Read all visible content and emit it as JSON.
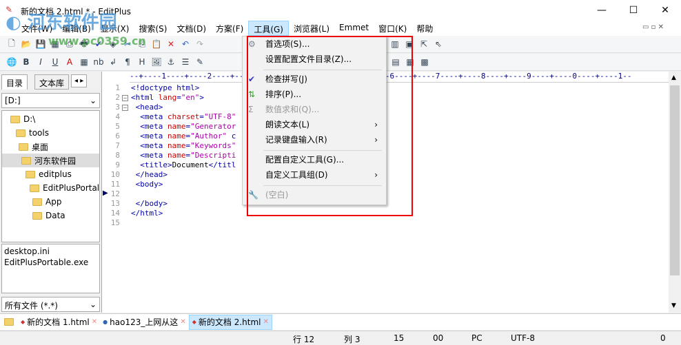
{
  "window": {
    "title": "新的文档 2.html * - EditPlus",
    "minimize": "—",
    "maximize": "☐",
    "close": "✕"
  },
  "watermark": {
    "name": "河东软件园",
    "url": "www.pc0359.cn"
  },
  "menubar": [
    "文件(W)",
    "编辑(B)",
    "显示(X)",
    "搜索(S)",
    "文档(D)",
    "方案(F)",
    "工具(G)",
    "浏览器(L)",
    "Emmet",
    "窗口(K)",
    "帮助"
  ],
  "left_panel": {
    "tabs": [
      "目录",
      "文本库"
    ],
    "drive": "[D:]",
    "tree": [
      "D:\\",
      "tools",
      "桌面",
      "河东软件园",
      "editplus",
      "EditPlusPortal",
      "App",
      "Data"
    ],
    "files": [
      "desktop.ini",
      "EditPlusPortable.exe"
    ],
    "filter": "所有文件 (*.*)"
  },
  "editor": {
    "ruler": "--+----1----+----2----+----3----+----4----+----5----+----6----+----7----+----8----+----9----+----0----+----1--",
    "lines": [
      {
        "n": "1",
        "t": "<!doctype html>"
      },
      {
        "n": "2",
        "t": "<html lang=\"en\">"
      },
      {
        "n": "3",
        "t": " <head>"
      },
      {
        "n": "4",
        "t": "  <meta charset=\"UTF-8\""
      },
      {
        "n": "5",
        "t": "  <meta name=\"Generator"
      },
      {
        "n": "6",
        "t": "  <meta name=\"Author\" c"
      },
      {
        "n": "7",
        "t": "  <meta name=\"Keywords\""
      },
      {
        "n": "8",
        "t": "  <meta name=\"Descripti"
      },
      {
        "n": "9",
        "t": "  <title>Document</titl"
      },
      {
        "n": "10",
        "t": " </head>"
      },
      {
        "n": "11",
        "t": " <body>"
      },
      {
        "n": "12",
        "t": ""
      },
      {
        "n": "13",
        "t": " </body>"
      },
      {
        "n": "14",
        "t": "</html>"
      },
      {
        "n": "15",
        "t": ""
      }
    ]
  },
  "tools_menu": {
    "items": [
      {
        "label": "首选项(S)...",
        "icon": "⚙"
      },
      {
        "label": "设置配置文件目录(Z)..."
      },
      {
        "label": "检查拼写(J)",
        "icon": "✔"
      },
      {
        "label": "排序(P)...",
        "icon": "⇅"
      },
      {
        "label": "数值求和(Q)...",
        "icon": "Σ"
      },
      {
        "label": "朗读文本(L)",
        "arrow": "›"
      },
      {
        "label": "记录键盘输入(R)",
        "arrow": "›"
      },
      {
        "label": "配置自定义工具(G)..."
      },
      {
        "label": "自定义工具组(D)",
        "arrow": "›"
      },
      {
        "label": "(空白)",
        "icon": "🔧"
      }
    ]
  },
  "doc_tabs": [
    {
      "label": "新的文档 1.html"
    },
    {
      "label": "hao123_上网从这"
    },
    {
      "label": "新的文档 2.html"
    }
  ],
  "status": {
    "line": "行 12",
    "col": "列 3",
    "total": "15",
    "code": "00",
    "eol": "PC",
    "encoding": "UTF-8",
    "count": "0"
  },
  "colors": {
    "highlight_box": "#e00000",
    "tab_active": "#cce8ff"
  }
}
